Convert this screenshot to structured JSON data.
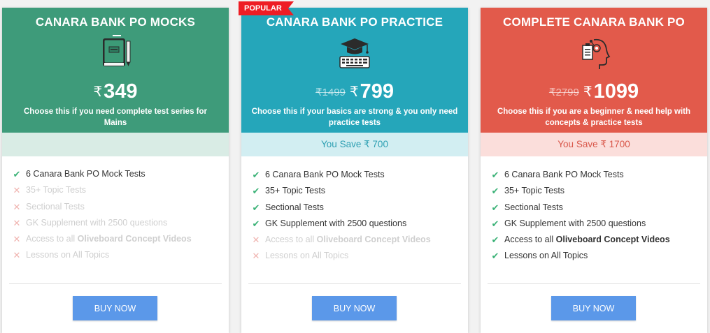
{
  "ribbon": "POPULAR",
  "currency": "₹",
  "cards": [
    {
      "title": "CANARA BANK PO MOCKS",
      "icon": "book-icon",
      "old_price": "",
      "price": "349",
      "tagline": "Choose this if you need complete test series for Mains",
      "save": "",
      "features": [
        {
          "text": "6 Canara Bank PO Mock Tests",
          "included": true
        },
        {
          "text": "35+ Topic Tests",
          "included": false
        },
        {
          "text": "Sectional Tests",
          "included": false
        },
        {
          "text": "GK Supplement with 2500 questions",
          "included": false
        },
        {
          "text": "Access to all ",
          "bold": "Oliveboard Concept Videos",
          "included": false
        },
        {
          "text": "Lessons on All Topics",
          "included": false
        }
      ],
      "button": "BUY NOW"
    },
    {
      "title": "CANARA BANK PO PRACTICE",
      "icon": "graduation-cap-keyboard-icon",
      "old_price": "₹1499",
      "price": "799",
      "tagline": "Choose this if your basics are strong & you only need practice tests",
      "save": "You Save ₹ 700",
      "features": [
        {
          "text": "6 Canara Bank PO Mock Tests",
          "included": true
        },
        {
          "text": "35+ Topic Tests",
          "included": true
        },
        {
          "text": "Sectional Tests",
          "included": true
        },
        {
          "text": "GK Supplement with 2500 questions",
          "included": true
        },
        {
          "text": "Access to all ",
          "bold": "Oliveboard Concept Videos",
          "included": false
        },
        {
          "text": "Lessons on All Topics",
          "included": false
        }
      ],
      "button": "BUY NOW"
    },
    {
      "title": "COMPLETE CANARA BANK PO",
      "icon": "head-checklist-icon",
      "old_price": "₹2799",
      "price": "1099",
      "tagline": "Choose this if you are a beginner & need help with concepts & practice tests",
      "save": "You Save ₹ 1700",
      "features": [
        {
          "text": "6 Canara Bank PO Mock Tests",
          "included": true
        },
        {
          "text": "35+ Topic Tests",
          "included": true
        },
        {
          "text": "Sectional Tests",
          "included": true
        },
        {
          "text": "GK Supplement with 2500 questions",
          "included": true
        },
        {
          "text": "Access to all ",
          "bold": "Oliveboard Concept Videos",
          "included": true
        },
        {
          "text": "Lessons on All Topics",
          "included": true
        }
      ],
      "button": "BUY NOW"
    }
  ],
  "colors": {
    "mocks": "#3e9b7a",
    "practice": "#25a6ba",
    "complete": "#e25a4b",
    "button": "#5b98e9",
    "ribbon": "#ee1d24",
    "check": "#3eb379",
    "cross": "#f0b4b0"
  }
}
